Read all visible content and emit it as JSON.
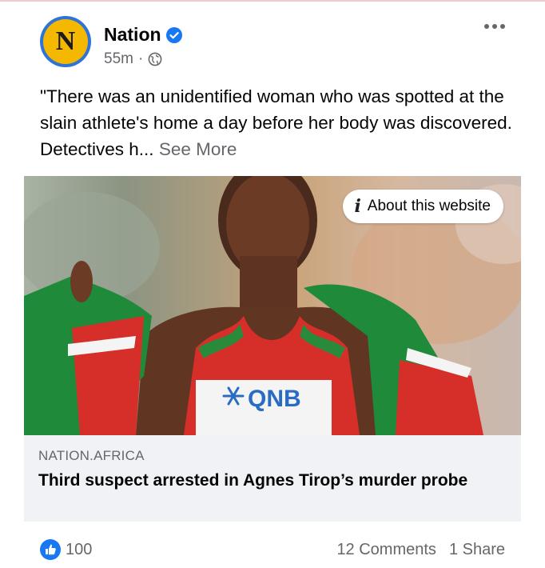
{
  "post": {
    "page_name": "Nation",
    "avatar_letter": "N",
    "time_ago": "55m",
    "meta_separator": "·",
    "text": "\"There was an unidentified woman who was spotted at the slain athlete's home a day before her body was discovered. Detectives h...",
    "see_more": "See More",
    "about_website": "About this website",
    "info_icon_glyph": "i",
    "bib_text": "QNB"
  },
  "link_preview": {
    "domain": "NATION.AFRICA",
    "title": "Third suspect arrested in Agnes Tirop’s murder probe"
  },
  "footer": {
    "reaction_count": "100",
    "comments": "12 Comments",
    "shares": "1 Share"
  },
  "colors": {
    "verified": "#1877f2",
    "avatar_ring": "#2e73d8",
    "avatar_fill": "#f5b800",
    "link_card_bg": "#f0f2f5",
    "muted_text": "#65676b"
  },
  "icons": [
    "verified-badge-icon",
    "globe-icon",
    "more-options-icon",
    "info-icon",
    "like-reaction-icon"
  ]
}
